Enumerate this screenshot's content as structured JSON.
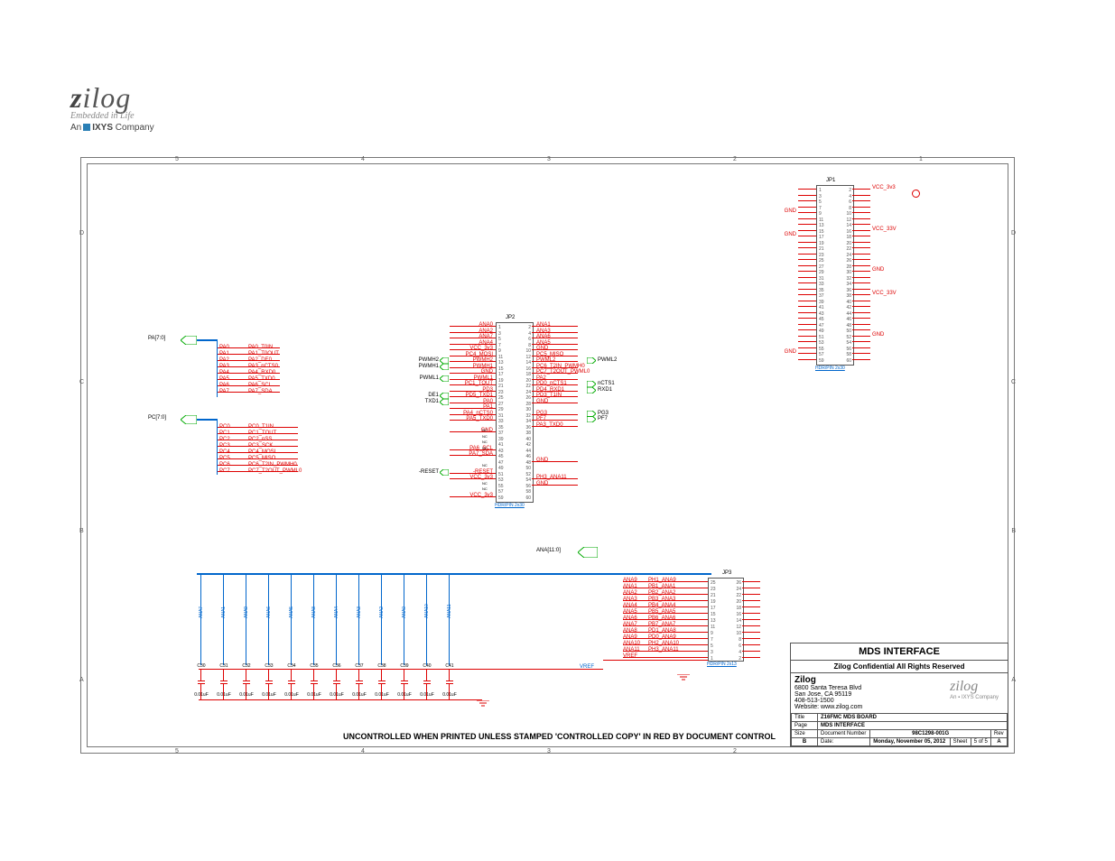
{
  "logo": {
    "word": "zilog",
    "tag": "Embedded in Life",
    "ixys": "An ▪ IXYS Company"
  },
  "zones_top": [
    "5",
    "4",
    "3",
    "2",
    "1"
  ],
  "zones_side": [
    "D",
    "C",
    "B",
    "A"
  ],
  "buses": {
    "pa": "PA[7:0]",
    "pc": "PC[7:0]",
    "ana": "ANA[11:0]"
  },
  "pa_rows": [
    {
      "n": "PA0",
      "f": "PA0_T0IN"
    },
    {
      "n": "PA1",
      "f": "PA1_T0OUT"
    },
    {
      "n": "PA2",
      "f": "PA2_DE0"
    },
    {
      "n": "PA3",
      "f": "PA3_nCTS0"
    },
    {
      "n": "PA4",
      "f": "PA4_RXD0"
    },
    {
      "n": "PA5",
      "f": "PA5_TXD0"
    },
    {
      "n": "PA6",
      "f": "PA6_SCL"
    },
    {
      "n": "PA7",
      "f": "PA7_SDA"
    }
  ],
  "pc_rows": [
    {
      "n": "PC0",
      "f": "PC0_T1IN"
    },
    {
      "n": "PC1",
      "f": "PC1_TOUT"
    },
    {
      "n": "PC2",
      "f": "PC2_nSS"
    },
    {
      "n": "PC3",
      "f": "PC3_SCK"
    },
    {
      "n": "PC4",
      "f": "PC4_MOSI"
    },
    {
      "n": "PC5",
      "f": "PC5_MISO"
    },
    {
      "n": "PC6",
      "f": "PC6_T2IN_PWMH0"
    },
    {
      "n": "PC7",
      "f": "PC7_T2OUT_PWML0"
    }
  ],
  "jp2": {
    "name": "JP2",
    "footer": "HDR/PIN 2x30",
    "left_sig": [
      "ANA0",
      "ANA2",
      "ANA7",
      "ANA4",
      "VCC_3v3",
      "PC4_MOSI",
      "PWMH2",
      "PWMH1",
      "GND",
      "PWML1",
      "PC1_TOUT",
      "PD3",
      "PD5_TXD1",
      "PA0",
      "PA1",
      "PA4_nCTS0",
      "PA5_TXD0",
      "",
      "GND",
      "",
      "",
      "PA6_SCL",
      "PA7_SDA",
      "",
      "",
      "-RESET",
      "VCC_3v3",
      "",
      "",
      "VCC_3v3"
    ],
    "left_port": [
      "",
      "",
      "",
      "",
      "",
      "",
      "PWMH2",
      "PWMH1",
      "",
      "PWML1",
      "",
      "",
      "DE1",
      "TXD1",
      "",
      "",
      "",
      "",
      "",
      "",
      "",
      "",
      "",
      "",
      "",
      "-RESET",
      "",
      "",
      "",
      ""
    ],
    "right_sig": [
      "ANA1",
      "ANA3",
      "ANA6",
      "ANA5",
      "GND",
      "PC5_MISO",
      "PWML2",
      "PC6_T2IN_PWMH0",
      "PC7_T2OUT_PWML0",
      "PA2",
      "PD0_nCTS1",
      "PD4_RXD1",
      "PD3_T1IN",
      "GND",
      "",
      "PG3",
      "PF7",
      "PA3_TXD0",
      "",
      "",
      "",
      "",
      "",
      "GND",
      "",
      "",
      "PH3_ANA11",
      "GND",
      "",
      ""
    ],
    "right_port": [
      "",
      "",
      "",
      "",
      "",
      "",
      "PWML2",
      "",
      "",
      "",
      "nCTS1",
      "RXD1",
      "",
      "",
      "",
      "PG3",
      "PF7",
      "",
      "",
      "",
      "",
      "",
      "",
      "",
      "",
      "",
      "",
      "",
      "",
      ""
    ]
  },
  "jp1": {
    "name": "JP1",
    "footer": "HDR/PIN 2x30",
    "left_power": {
      "4": "GND",
      "8": "GND",
      "28": "GND"
    },
    "right_power": {
      "0": "VCC_3v3",
      "7": "VCC_33V",
      "14": "GND",
      "18": "VCC_33V",
      "25": "GND"
    }
  },
  "jp3": {
    "name": "JP3",
    "footer": "HDR/PIN 2x13",
    "rows": [
      {
        "l": "VREF",
        "m": "",
        "p1": 1,
        "p2": 2
      },
      {
        "l": "ANA11",
        "m": "PH3_ANA11",
        "p1": 3,
        "p2": 4
      },
      {
        "l": "ANA10",
        "m": "PH2_ANA10",
        "p1": 5,
        "p2": 6
      },
      {
        "l": "ANA9",
        "m": "PD0_ANA9",
        "p1": 7,
        "p2": 8
      },
      {
        "l": "ANA8",
        "m": "PD1_ANA8",
        "p1": 9,
        "p2": 10
      },
      {
        "l": "ANA7",
        "m": "PB7_ANA7",
        "p1": 11,
        "p2": 12
      },
      {
        "l": "ANA6",
        "m": "PB6_ANA6",
        "p1": 13,
        "p2": 14
      },
      {
        "l": "ANA5",
        "m": "PB5_ANA5",
        "p1": 15,
        "p2": 16
      },
      {
        "l": "ANA4",
        "m": "PB4_ANA4",
        "p1": 17,
        "p2": 18
      },
      {
        "l": "ANA3",
        "m": "PB3_ANA3",
        "p1": 19,
        "p2": 20
      },
      {
        "l": "ANA2",
        "m": "PB2_ANA2",
        "p1": 21,
        "p2": 22
      },
      {
        "l": "ANA1",
        "m": "PB1_ANA1",
        "p1": 23,
        "p2": 24
      },
      {
        "l": "ANA9",
        "m": "PH1_ANA9",
        "p1": 25,
        "p2": 26
      }
    ]
  },
  "caps": [
    {
      "ref": "C30",
      "val": "0.01uF"
    },
    {
      "ref": "C31",
      "val": "0.01uF"
    },
    {
      "ref": "C32",
      "val": "0.01uF"
    },
    {
      "ref": "C33",
      "val": "0.01uF"
    },
    {
      "ref": "C34",
      "val": "0.01uF"
    },
    {
      "ref": "C35",
      "val": "0.01uF"
    },
    {
      "ref": "C36",
      "val": "0.01uF"
    },
    {
      "ref": "C37",
      "val": "0.01uF"
    },
    {
      "ref": "C38",
      "val": "0.01uF"
    },
    {
      "ref": "C39",
      "val": "0.01uF"
    },
    {
      "ref": "C40",
      "val": "0.01uF"
    },
    {
      "ref": "C41",
      "val": "0.01uF"
    }
  ],
  "ana_bus": [
    "ANA7",
    "ANA1",
    "ANA9",
    "ANA6",
    "ANA5",
    "ANA8",
    "ANA4",
    "ANA3",
    "ANA2",
    "ANA0",
    "ANA10",
    "ANA11"
  ],
  "vref": "VREF",
  "nc": "NC",
  "disclaimer": "UNCONTROLLED WHEN PRINTED UNLESS STAMPED 'CONTROLLED COPY' IN RED BY DOCUMENT CONTROL",
  "titleblock": {
    "title": "MDS INTERFACE",
    "conf": "Zilog Confidential All Rights Reserved",
    "company": "Zilog",
    "addr1": "6800 Santa Teresa Blvd",
    "addr2": "San Jose, CA  95119",
    "phone": "408-513-1500",
    "web": "Website: www.zilog.com",
    "file_h": "Title",
    "file": "Z16FMC MDS BOARD",
    "page_h": "Page",
    "page": "MDS INTERFACE",
    "size_h": "Size",
    "size": "B",
    "docnum_h": "Document Number",
    "docnum": "98C1298-001G",
    "rev_h": "Rev",
    "rev": "A",
    "date_h": "Date:",
    "date": "Monday, November 05, 2012",
    "sheet_h": "Sheet",
    "sheet_n": "5",
    "sheet_of": "of",
    "sheet_t": "5"
  }
}
